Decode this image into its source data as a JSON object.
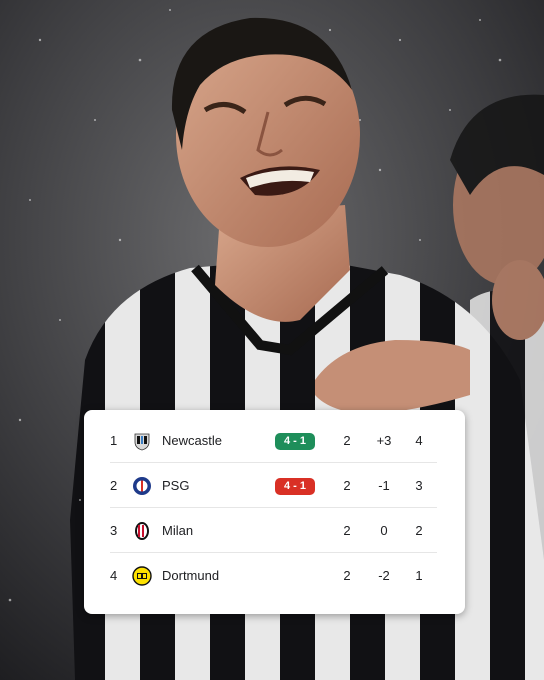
{
  "standings": [
    {
      "pos": "1",
      "crest": "newcastle-crest-icon",
      "team": "Newcastle",
      "result": "4 - 1",
      "result_color": "#1e8e5a",
      "played": "2",
      "gd": "+3",
      "pts": "4"
    },
    {
      "pos": "2",
      "crest": "psg-crest-icon",
      "team": "PSG",
      "result": "4 - 1",
      "result_color": "#d93025",
      "played": "2",
      "gd": "-1",
      "pts": "3"
    },
    {
      "pos": "3",
      "crest": "milan-crest-icon",
      "team": "Milan",
      "result": "",
      "result_color": "",
      "played": "2",
      "gd": "0",
      "pts": "2"
    },
    {
      "pos": "4",
      "crest": "dortmund-crest-icon",
      "team": "Dortmund",
      "result": "",
      "result_color": "",
      "played": "2",
      "gd": "-2",
      "pts": "1"
    }
  ],
  "colors": {
    "win_badge": "#1e8e5a",
    "loss_badge": "#d93025",
    "card_bg": "#ffffff"
  }
}
